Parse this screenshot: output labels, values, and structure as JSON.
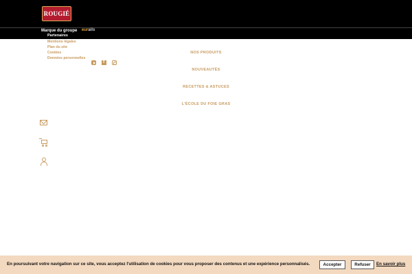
{
  "brand": {
    "logo_text": "ROUGIÉ"
  },
  "group": {
    "label": "Marque du groupe",
    "partner_logo_prefix": "eur",
    "partner_logo_suffix": "alis",
    "partners_link": "Partenaires"
  },
  "footer_links": [
    "Mentions légales",
    "Plan du site",
    "Cookies",
    "Données personnelles"
  ],
  "social": [
    "youtube-icon",
    "facebook-icon",
    "instagram-icon"
  ],
  "nav": {
    "items": [
      "NOS PRODUITS",
      "NOUVEAUTÉS",
      "RECETTES & ASTUCES",
      "L'ÉCOLE DU FOIE GRAS"
    ]
  },
  "side_icons": [
    "mail-icon",
    "cart-icon",
    "user-icon"
  ],
  "cookie": {
    "message": "En poursuivant votre navigation sur ce site, vous acceptez l'utilisation de cookies pour vous proposer des contenus et une expérience personnalisés.",
    "accept_label": "Accepter",
    "refuse_label": "Refuser",
    "more_label": "En savoir plus"
  },
  "colors": {
    "accent": "#c79a5e",
    "bar_bg": "#000000",
    "cookie_bg": "#f3d9c0",
    "logo_red": "#b31b2e"
  }
}
